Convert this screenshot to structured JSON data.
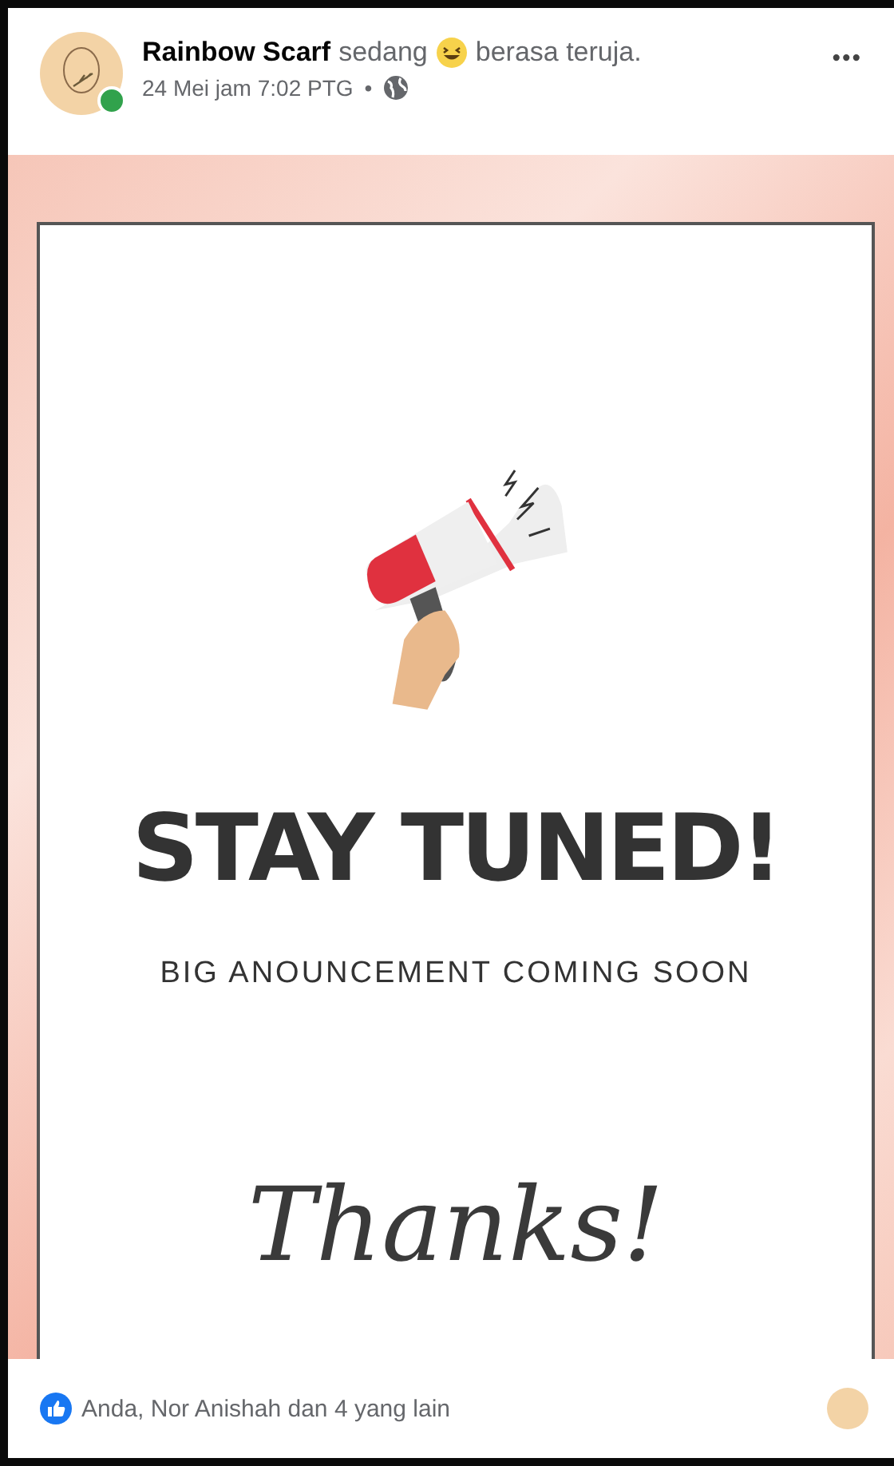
{
  "post": {
    "author": "Rainbow Scarf",
    "activity": "sedang",
    "feeling": "berasa teruja.",
    "timestamp": "24 Mei jam 7:02 PTG",
    "separator": "•",
    "online": true,
    "menu": "•••"
  },
  "poster": {
    "headline": "STAY TUNED!",
    "subheadline": "BIG ANOUNCEMENT COMING SOON",
    "signoff": "Thanks!"
  },
  "reactions": {
    "summary": "Anda, Nor Anishah dan 4 yang lain"
  }
}
